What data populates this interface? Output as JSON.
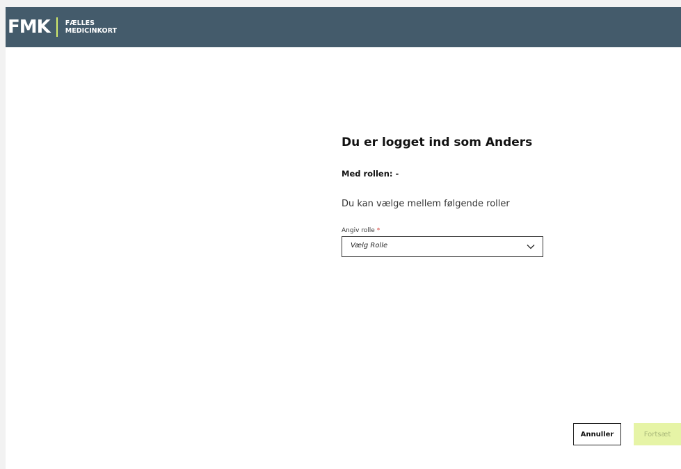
{
  "header": {
    "logo_mark": "FMK",
    "logo_line1": "FÆLLES",
    "logo_line2": "MEDICINKORT",
    "background_color": "#445b6b",
    "accent_color": "#d4ec6b"
  },
  "login": {
    "title": "Du er logget ind som Anders",
    "role_line": "Med rollen: -",
    "subtitle": "Du kan vælge mellem følgende roller"
  },
  "role_field": {
    "label": "Angiv rolle",
    "required_marker": "*",
    "selected_value": "Vælg Rolle",
    "icon": "chevron-down-icon"
  },
  "actions": {
    "cancel_label": "Annuller",
    "continue_label": "Fortsæt",
    "continue_color": "#e6f4a6"
  }
}
